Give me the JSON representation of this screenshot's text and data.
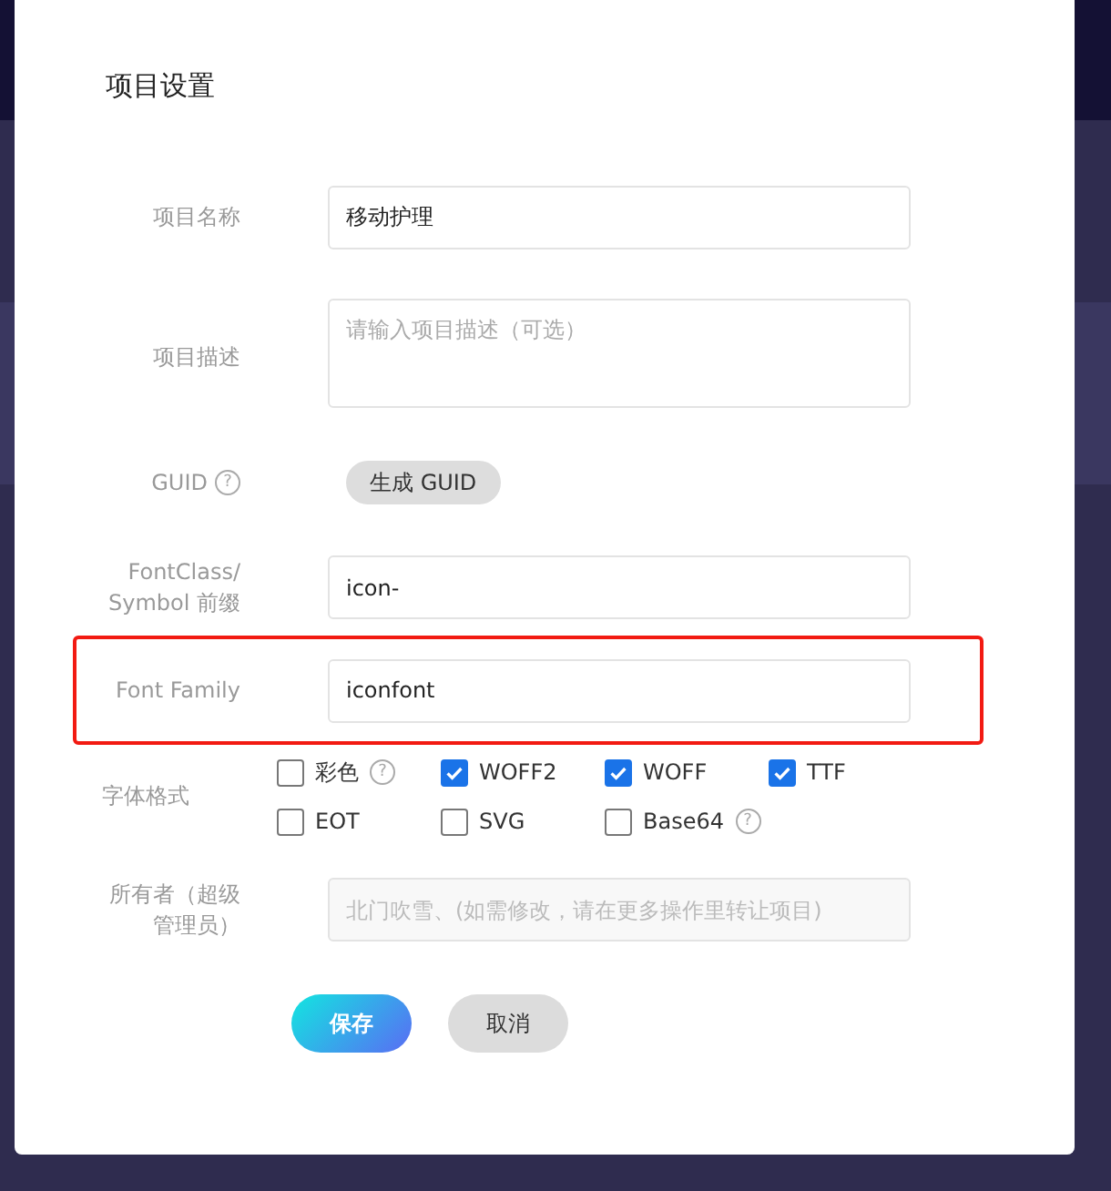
{
  "dialog": {
    "title": "项目设置"
  },
  "fields": [
    {
      "kind": "input",
      "label": "项目名称",
      "value": "移动护理",
      "highlighted": false
    },
    {
      "kind": "textarea",
      "label": "项目描述",
      "placeholder": "请输入项目描述（可选）",
      "highlighted": false
    },
    {
      "kind": "action",
      "label": "GUID",
      "help": "?",
      "button": "生成 GUID",
      "highlighted": false
    },
    {
      "kind": "input",
      "label": "FontClass/ Symbol 前缀",
      "value": "icon-",
      "highlighted": false
    },
    {
      "kind": "input",
      "label": "Font Family",
      "value": "iconfont",
      "highlighted": true
    },
    {
      "kind": "checkboxes",
      "label": "字体格式",
      "highlighted": false,
      "options": [
        {
          "label": "彩色",
          "checked": false,
          "help": "?"
        },
        {
          "label": "WOFF2",
          "checked": true
        },
        {
          "label": "WOFF",
          "checked": true
        },
        {
          "label": "TTF",
          "checked": true
        },
        {
          "label": "EOT",
          "checked": false
        },
        {
          "label": "SVG",
          "checked": false
        },
        {
          "label": "Base64",
          "checked": false,
          "help": "?"
        }
      ]
    },
    {
      "kind": "disabled",
      "label": "所有者（超级管理员）",
      "placeholder": "北门吹雪、(如需修改，请在更多操作里转让项目)",
      "highlighted": false
    }
  ],
  "buttons": [
    {
      "label": "保存",
      "kind": "primary"
    },
    {
      "label": "取消",
      "kind": "secondary"
    }
  ]
}
